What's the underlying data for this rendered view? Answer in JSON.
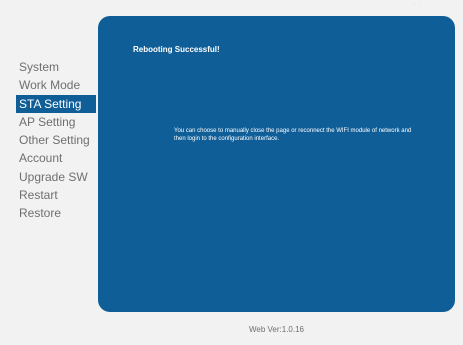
{
  "sidebar": {
    "items": [
      {
        "label": "System"
      },
      {
        "label": "Work Mode"
      },
      {
        "label": "STA Setting",
        "active": true
      },
      {
        "label": "AP Setting"
      },
      {
        "label": "Other Setting"
      },
      {
        "label": "Account"
      },
      {
        "label": "Upgrade SW"
      },
      {
        "label": "Restart"
      },
      {
        "label": "Restore"
      }
    ]
  },
  "panel": {
    "title": "Rebooting Successful!",
    "message": "You can choose to manually close the page or reconnect the WIFI module of network and then login to the configuration interface."
  },
  "footer": {
    "version": "Web Ver:1.0.16"
  },
  "colors": {
    "accent": "#0f5e98",
    "background": "#f2f2f2",
    "text_muted": "#6f6f6f"
  }
}
